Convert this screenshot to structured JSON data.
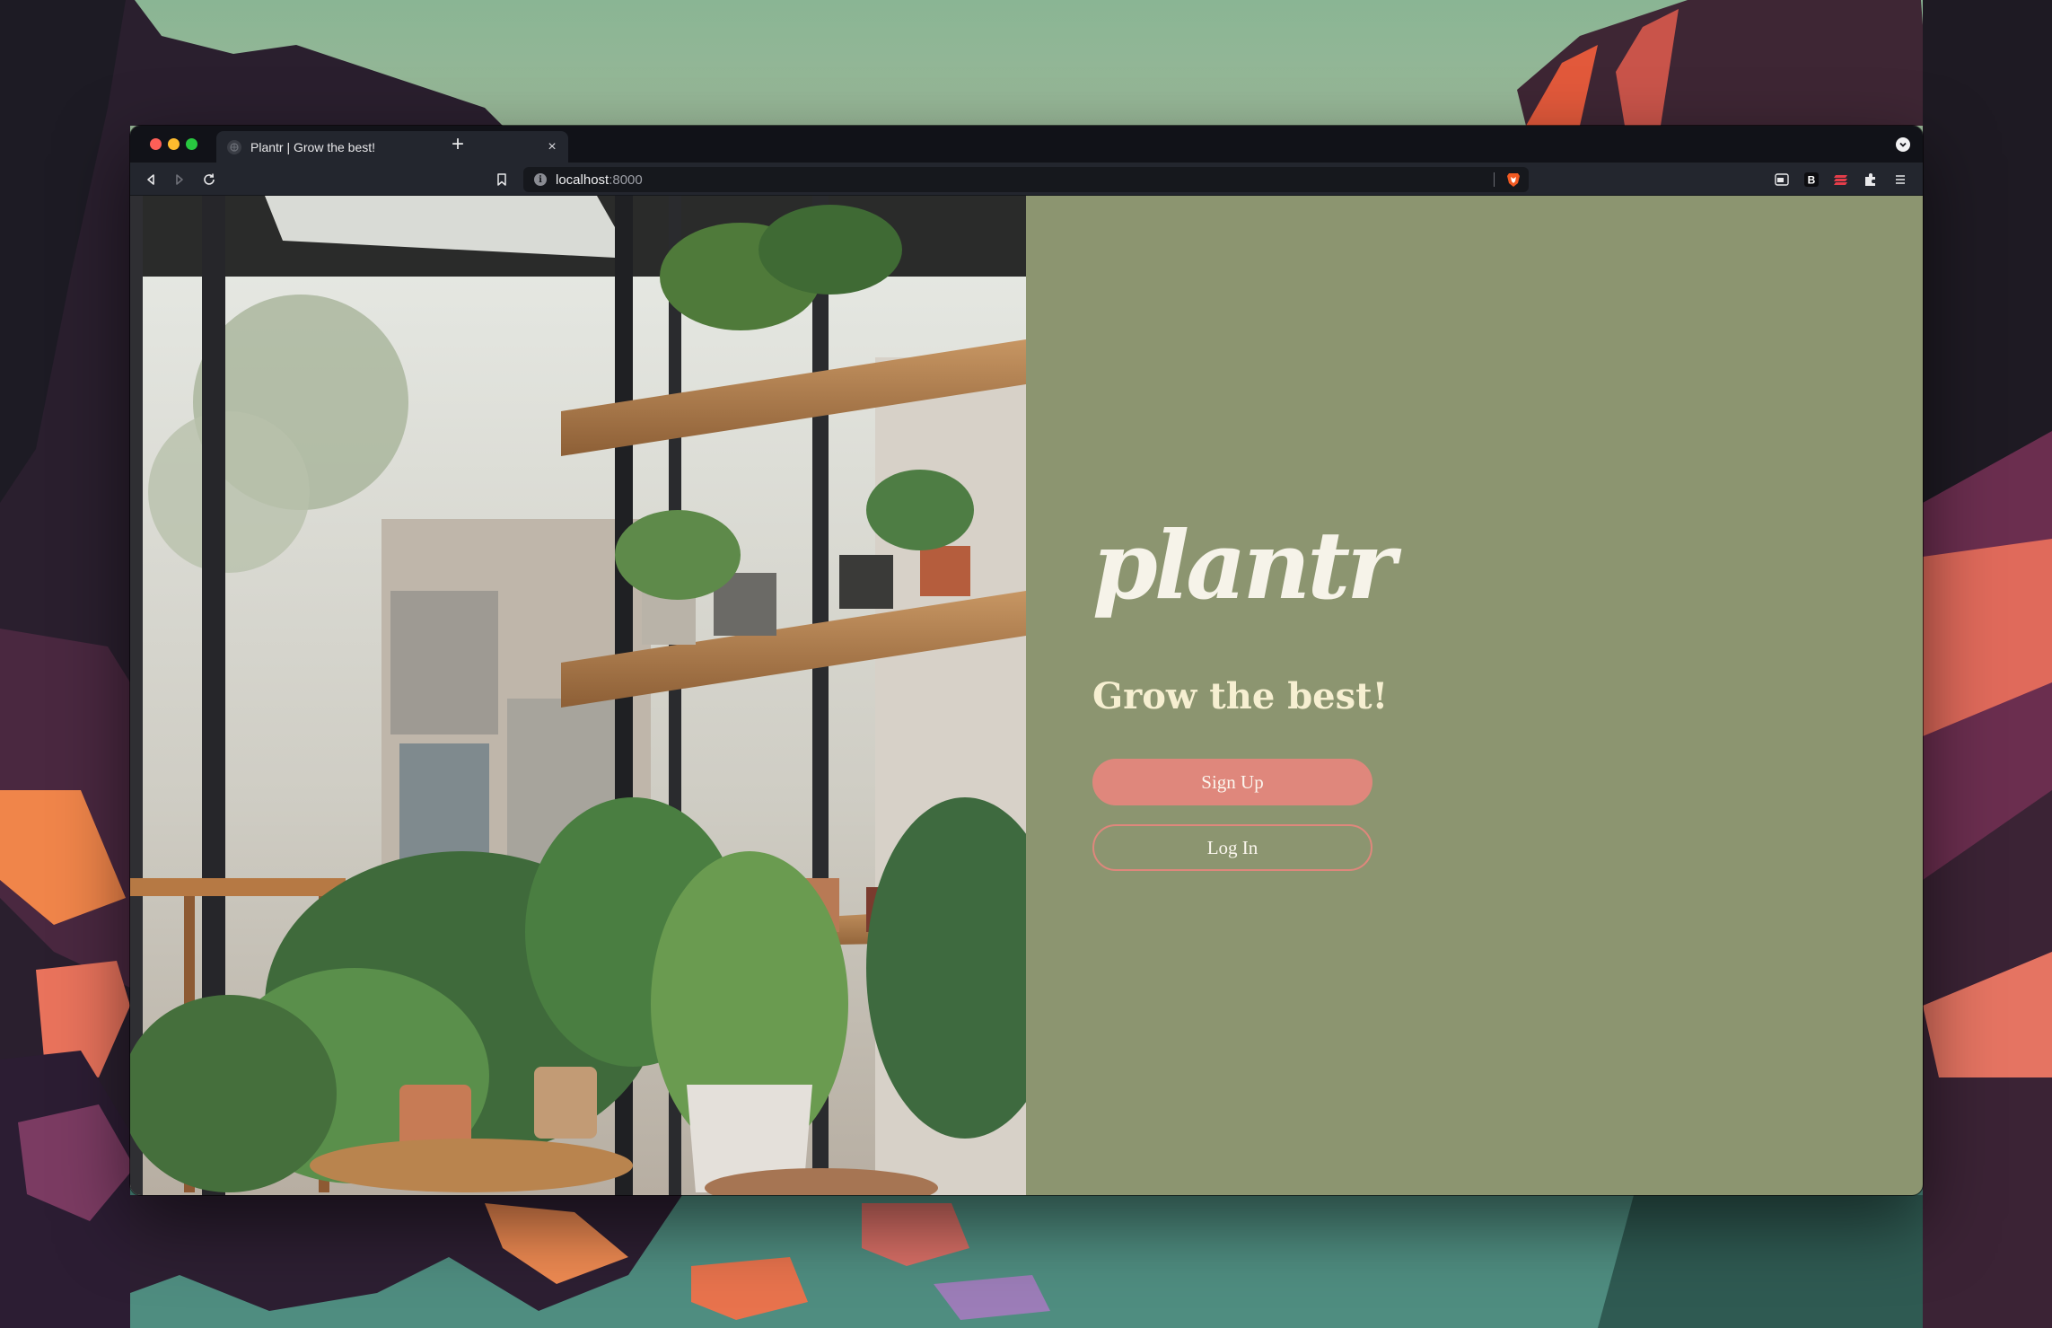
{
  "browser": {
    "tab": {
      "title": "Plantr | Grow the best!",
      "close_glyph": "×"
    },
    "new_tab_glyph": "+",
    "url": {
      "host": "localhost",
      "port": ":8000"
    },
    "extensions": [
      "reader-mode-icon",
      "bold-b-icon",
      "stack-icon",
      "puzzle-icon",
      "hamburger-menu-icon"
    ]
  },
  "page": {
    "logo": "plantr",
    "tagline": "Grow the best!",
    "signup_label": "Sign Up",
    "login_label": "Log In",
    "colors": {
      "panel_bg": "#8c9570",
      "accent": "#df877c",
      "logo": "#f6f3e9",
      "tagline": "#f6efd1"
    }
  }
}
